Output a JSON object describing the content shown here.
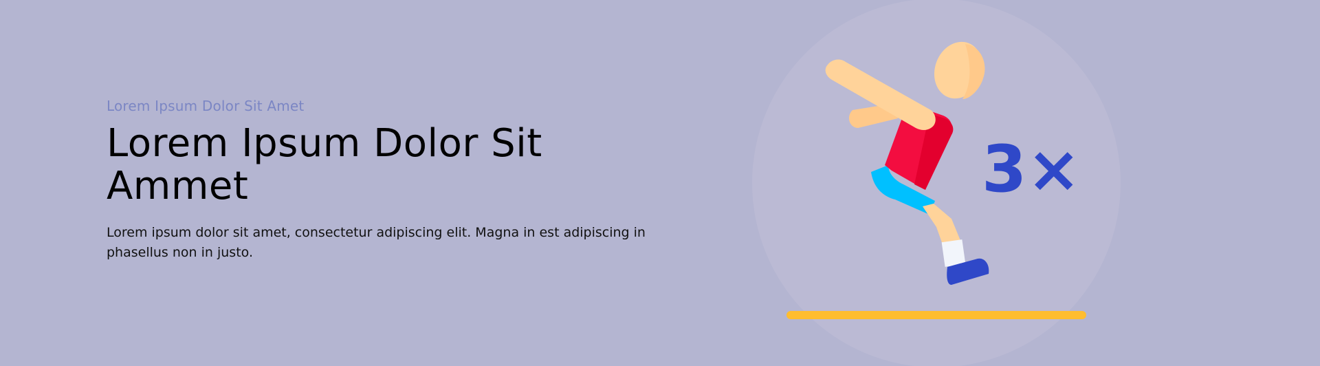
{
  "hero": {
    "eyebrow": "Lorem Ipsum Dolor Sit Amet",
    "title": "Lorem Ipsum Dolor Sit Ammet",
    "description": "Lorem ipsum dolor sit amet, consectetur adipiscing elit. Magna in est adipiscing in phasellus non in justo."
  },
  "illustration": {
    "icon": "jumping-athlete-icon",
    "multiplier_label": "3×"
  },
  "colors": {
    "background": "#b4b5d1",
    "eyebrow": "#7b86c4",
    "accent_blue": "#2f48c8",
    "ground_line": "#ffbd2f",
    "shirt": "#f30d40",
    "shorts": "#00c0ff",
    "skin": "#ffd39a"
  }
}
